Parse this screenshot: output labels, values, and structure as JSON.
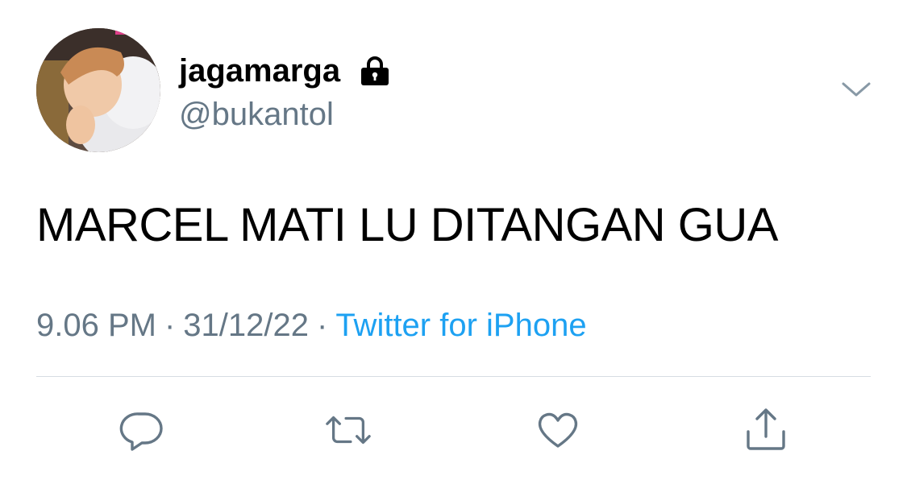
{
  "user": {
    "display_name": "jagamarga",
    "handle": "@bukantol",
    "protected_icon": "lock-icon",
    "avatar_icon": "avatar-photo"
  },
  "tweet": {
    "text": "MARCEL MATI LU DITANGAN GUA",
    "time": "9.06 PM",
    "separator": "·",
    "date": "31/12/22",
    "source": "Twitter for iPhone"
  },
  "menu": {
    "icon": "chevron-down-icon"
  },
  "actions": [
    {
      "icon": "reply-icon"
    },
    {
      "icon": "retweet-icon"
    },
    {
      "icon": "like-icon"
    },
    {
      "icon": "share-icon"
    }
  ],
  "colors": {
    "text": "#000000",
    "secondary": "#657786",
    "accent": "#1da1f2",
    "divider": "#d6dde3"
  }
}
